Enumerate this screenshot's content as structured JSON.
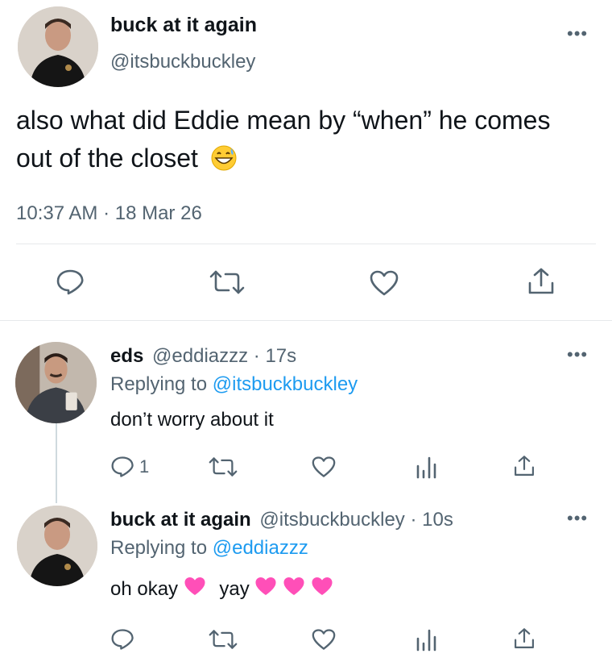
{
  "main_tweet": {
    "display_name": "buck at it again",
    "handle": "@itsbuckbuckley",
    "text": "also what did Eddie mean by “when” he comes out of the closet",
    "emoji": "grinning-face-with-sweat",
    "timestamp": "10:37 AM · 18 Mar 26",
    "more_label": "•••"
  },
  "reply_1": {
    "display_name": "eds",
    "handle_time": "@eddiazzz · 17s",
    "replying_prefix": "Replying to",
    "replying_handle": "@itsbuckbuckley",
    "text": "don’t worry about it",
    "reply_count": "1",
    "more_label": "•••"
  },
  "reply_2": {
    "display_name": "buck at it again",
    "handle_time": "@itsbuckbuckley · 10s",
    "replying_prefix": "Replying to",
    "replying_handle": "@eddiazzz",
    "text_a": "oh okay",
    "text_b": "yay",
    "more_label": "•••"
  },
  "colors": {
    "link": "#1d9bf0",
    "secondary": "#536471",
    "heart_emoji": "#ff4fb8"
  },
  "icons": [
    "reply-icon",
    "retweet-icon",
    "like-icon",
    "analytics-icon",
    "share-icon",
    "more-icon",
    "pink-heart-icon"
  ]
}
